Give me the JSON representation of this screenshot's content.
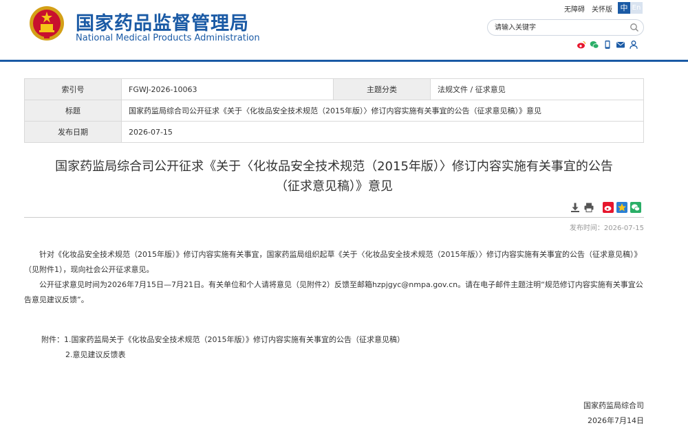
{
  "header": {
    "title_cn": "国家药品监督管理局",
    "title_en": "National Medical Products Administration",
    "links": [
      "无障碍",
      "关怀版"
    ],
    "lang_zh": "中",
    "lang_en": "En",
    "search_placeholder": "请输入关键字",
    "social_icons": [
      "weibo-icon",
      "wechat-icon",
      "mobile-icon",
      "mail-icon",
      "user-icon"
    ],
    "brand_color": "#1a5aa5"
  },
  "meta": {
    "index_label": "索引号",
    "index_value": "FGWJ-2026-10063",
    "category_label": "主题分类",
    "category_value": "法规文件 / 征求意见",
    "title_label": "标题",
    "title_value": "国家药监局综合司公开征求《关于〈化妆品安全技术规范（2015年版）〉修订内容实施有关事宜的公告（征求意见稿）》意见",
    "date_label": "发布日期",
    "date_value": "2026-07-15"
  },
  "article": {
    "title_line1": "国家药监局综合司公开征求《关于〈化妆品安全技术规范（2015年版）〉修订内容实施有关事宜的公告",
    "title_line2": "（征求意见稿）》意见",
    "pub_time": "发布时间：2026-07-15",
    "paragraphs": [
      "针对《化妆品安全技术规范（2015年版）》修订内容实施有关事宜，国家药监局组织起草《关于〈化妆品安全技术规范（2015年版）〉修订内容实施有关事宜的公告（征求意见稿）》（见附件1），现向社会公开征求意见。",
      "公开征求意见时间为2026年7月15日—7月21日。有关单位和个人请将意见（见附件2）反馈至邮箱hzpjgyc@nmpa.gov.cn。请在电子邮件主题注明“规范修订内容实施有关事宜公告意见建议反馈”。"
    ],
    "attachment_1": "附件：1.国家药监局关于《化妆品安全技术规范（2015年版）》修订内容实施有关事宜的公告（征求意见稿）",
    "attachment_2": "2.意见建议反馈表",
    "signer": "国家药监局综合司",
    "sign_date": "2026年7月14日"
  },
  "tools": [
    "download-icon",
    "print-icon",
    "weibo-share-icon",
    "qzone-share-icon",
    "wechat-share-icon"
  ]
}
